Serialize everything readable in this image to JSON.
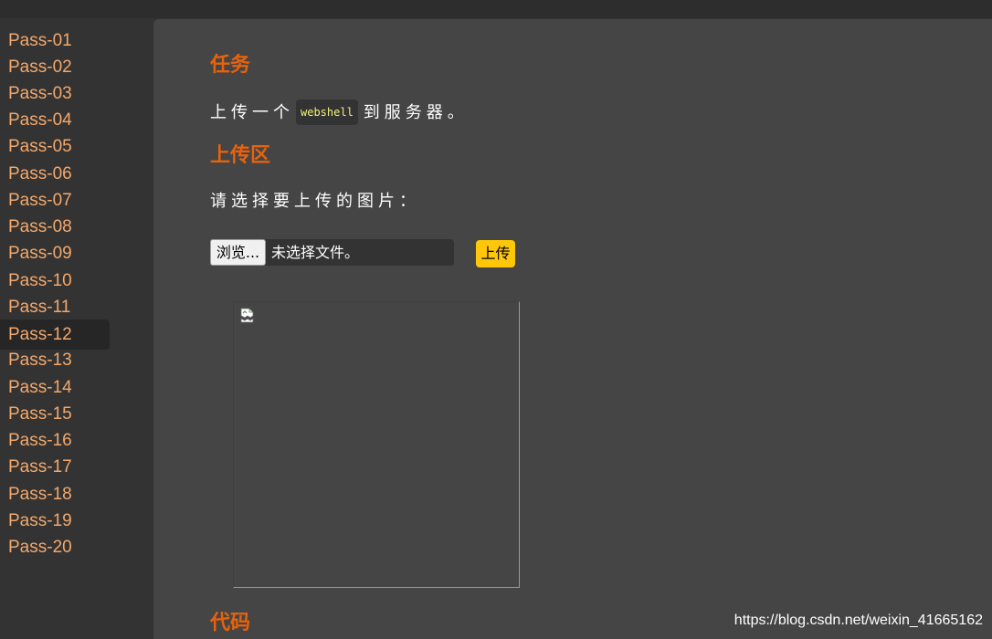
{
  "sidebar": {
    "items": [
      {
        "label": "Pass-01"
      },
      {
        "label": "Pass-02"
      },
      {
        "label": "Pass-03"
      },
      {
        "label": "Pass-04"
      },
      {
        "label": "Pass-05"
      },
      {
        "label": "Pass-06"
      },
      {
        "label": "Pass-07"
      },
      {
        "label": "Pass-08"
      },
      {
        "label": "Pass-09"
      },
      {
        "label": "Pass-10"
      },
      {
        "label": "Pass-11"
      },
      {
        "label": "Pass-12",
        "active": true
      },
      {
        "label": "Pass-13"
      },
      {
        "label": "Pass-14"
      },
      {
        "label": "Pass-15"
      },
      {
        "label": "Pass-16"
      },
      {
        "label": "Pass-17"
      },
      {
        "label": "Pass-18"
      },
      {
        "label": "Pass-19"
      },
      {
        "label": "Pass-20"
      }
    ]
  },
  "task": {
    "heading": "任务",
    "text_before": "上传一个",
    "code": "webshell",
    "text_after": "到服务器。"
  },
  "upload": {
    "heading": "上传区",
    "prompt": "请选择要上传的图片：",
    "browse_label": "浏览...",
    "file_status": "未选择文件。",
    "submit_label": "上传"
  },
  "preview": {
    "icon": "broken-image-icon"
  },
  "code_section": {
    "heading": "代码"
  },
  "watermark": {
    "text": "https://blog.csdn.net/weixin_41665162"
  },
  "colors": {
    "nav_text": "#f3a86b",
    "heading": "#e8620c",
    "upload_button": "#ffc709",
    "code_text": "#f3f17a",
    "panel": "#454545",
    "sidebar": "#333333"
  }
}
